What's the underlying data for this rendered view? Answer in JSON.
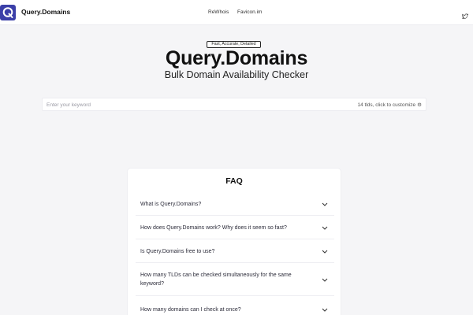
{
  "header": {
    "brand": "Query.Domains",
    "logo_letter": "Q",
    "nav": [
      {
        "label": "ReWhois"
      },
      {
        "label": "Favicon.im"
      }
    ],
    "icons": {
      "social": "twitter-icon"
    },
    "colors": {
      "logo_bg": "#3b3fa8"
    }
  },
  "hero": {
    "badge": "Fast, Accurate, Detailed",
    "title": "Query.Domains",
    "subtitle": "Bulk Domain Availability Checker"
  },
  "search": {
    "placeholder": "Enter your keyword",
    "value": "",
    "tld_info": "14 tlds, click to customize",
    "icon": "gear-icon"
  },
  "faq": {
    "title": "FAQ",
    "items": [
      {
        "question": "What is Query.Domains?"
      },
      {
        "question": "How does Query.Domains work? Why does it seem so fast?"
      },
      {
        "question": "Is Query.Domains free to use?"
      },
      {
        "question": "How many TLDs can be checked simultaneously for the same keyword?"
      },
      {
        "question": "How many domains can I check at once?"
      }
    ]
  }
}
